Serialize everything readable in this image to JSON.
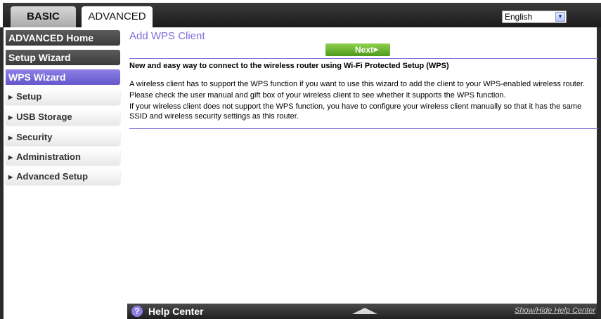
{
  "tabs": {
    "basic": "BASIC",
    "advanced": "ADVANCED"
  },
  "language": {
    "selected": "English"
  },
  "sidebar": {
    "main_items": [
      "ADVANCED Home",
      "Setup Wizard",
      "WPS Wizard"
    ],
    "sub_items": [
      "Setup",
      "USB Storage",
      "Security",
      "Administration",
      "Advanced Setup"
    ]
  },
  "main": {
    "title": "Add WPS Client",
    "next_label": "Next",
    "heading": "New and easy way to connect to the wireless router using Wi-Fi Protected Setup (WPS)",
    "paragraphs": [
      "A wireless client has to support the WPS function if you want to use this wizard to add the client to your WPS-enabled wireless router.",
      "Please check the user manual and gift box of your wireless client to see whether it supports the WPS function.",
      "If your wireless client does not support the WPS function, you have to configure your wireless client manually so that it has the same SSID and wireless security settings as this router."
    ]
  },
  "help": {
    "label": "Help Center",
    "link": "Show/Hide Help Center"
  },
  "colors": {
    "accent": "#7a6fd8",
    "active_nav": "#6656cc",
    "next_button": "#4e9a1c"
  }
}
